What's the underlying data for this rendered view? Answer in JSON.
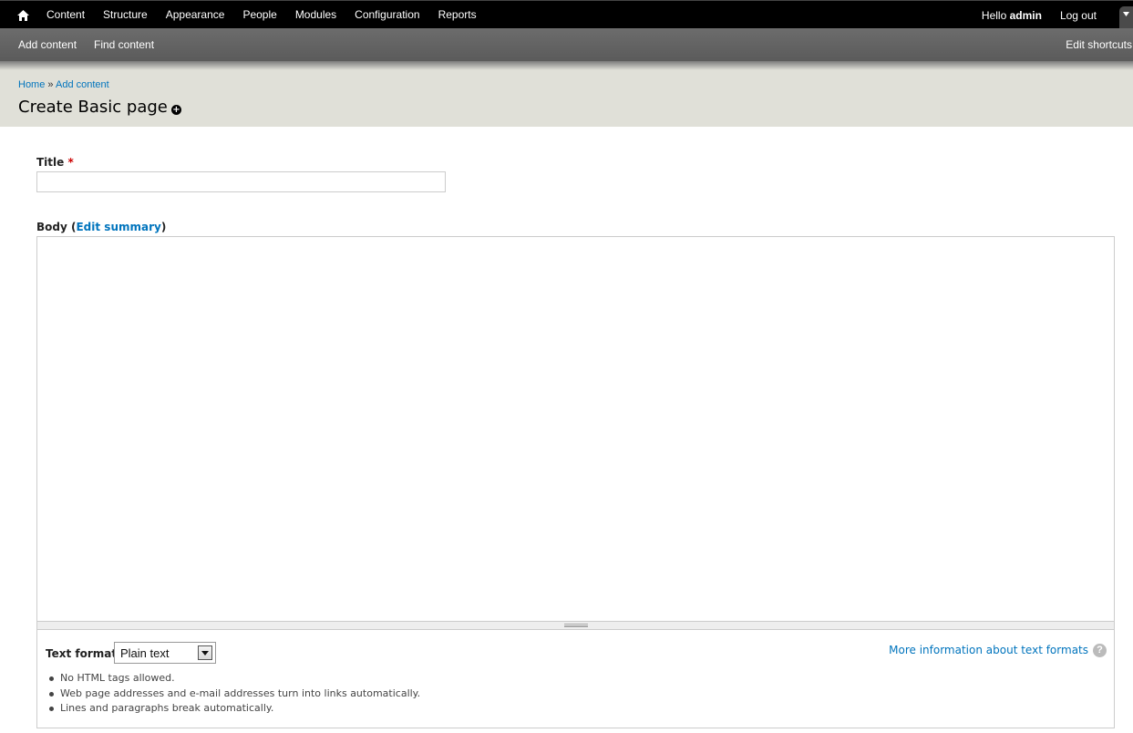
{
  "toolbar": {
    "menu": [
      "Content",
      "Structure",
      "Appearance",
      "People",
      "Modules",
      "Configuration",
      "Reports"
    ],
    "hello": "Hello",
    "username": "admin",
    "logout": "Log out"
  },
  "shortcuts": {
    "items": [
      "Add content",
      "Find content"
    ],
    "edit": "Edit shortcuts"
  },
  "breadcrumb": {
    "home": "Home",
    "separator": "»",
    "current": "Add content"
  },
  "page": {
    "title": "Create Basic page"
  },
  "form": {
    "title_label": "Title",
    "required_mark": "*",
    "title_value": "",
    "body_label": "Body",
    "body_open": "(",
    "edit_summary": "Edit summary",
    "body_close": ")",
    "body_value": "",
    "text_format_label": "Text format",
    "text_format_selected": "Plain text",
    "more_info": "More information about text formats",
    "help_symbol": "?",
    "tips": [
      "No HTML tags allowed.",
      "Web page addresses and e-mail addresses turn into links automatically.",
      "Lines and paragraphs break automatically."
    ]
  }
}
